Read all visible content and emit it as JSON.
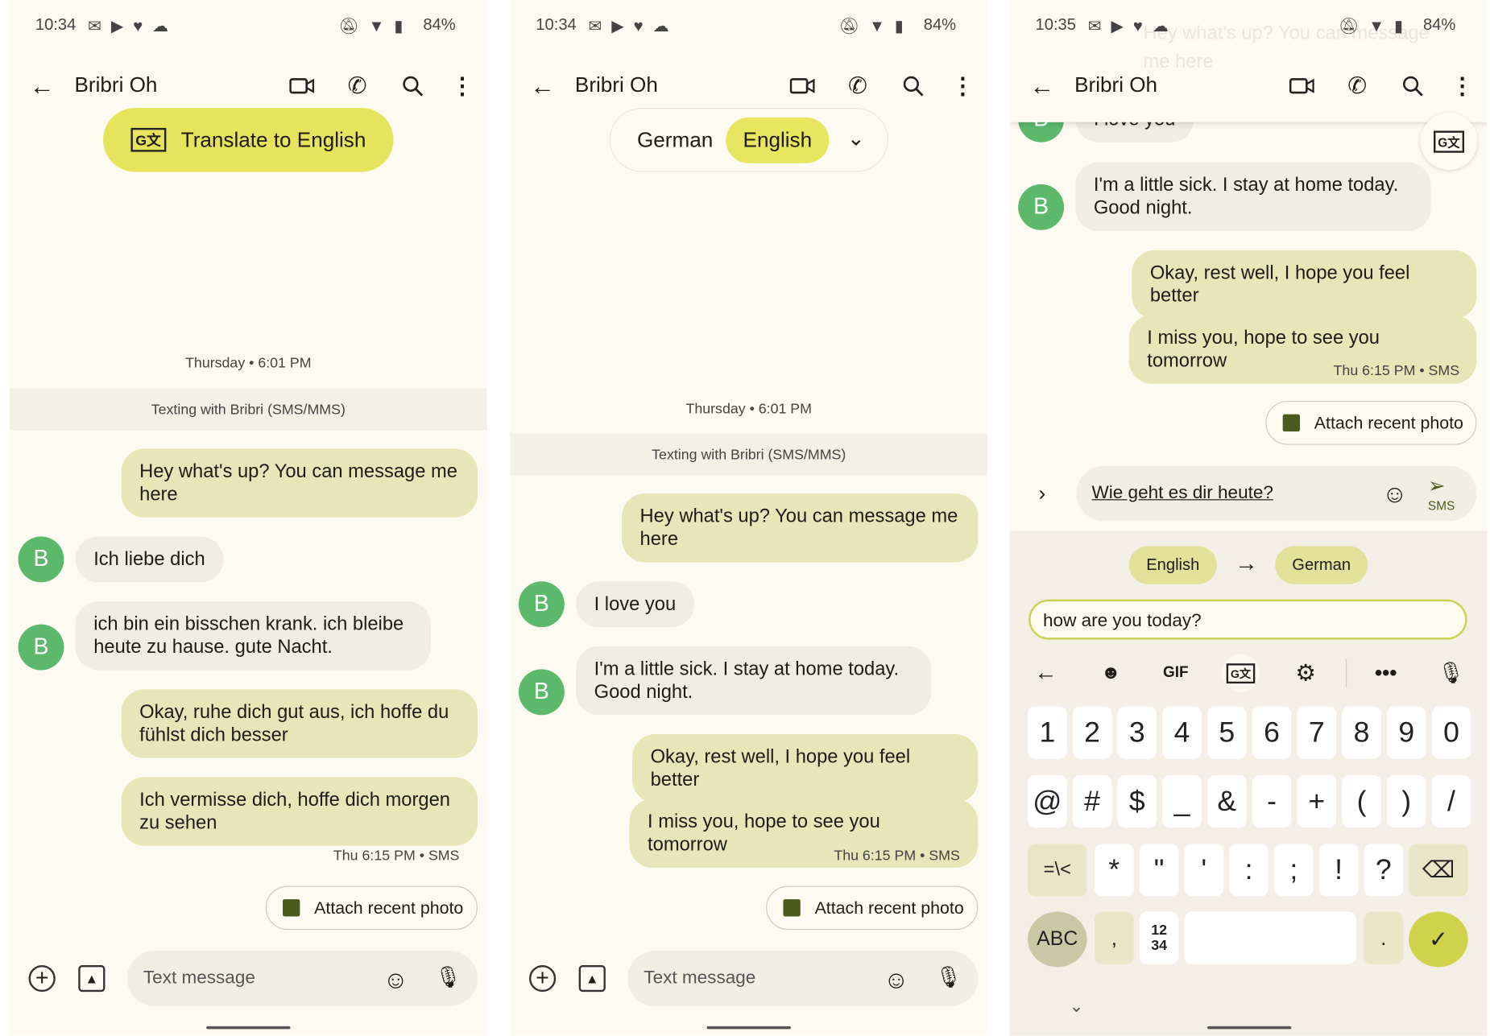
{
  "status_bar": [
    {
      "time": "10:34",
      "battery": "84%"
    },
    {
      "time": "10:34",
      "battery": "84%"
    },
    {
      "time": "10:35",
      "battery": "84%"
    }
  ],
  "contact_name": "Bribri Oh",
  "colors": {
    "background": "#fdfaf1",
    "outgoing_bubble": "#e8e5b8",
    "incoming_bubble": "#f0ede3",
    "avatar": "#5cb96c",
    "accent_yellow": "#e6e35c"
  },
  "panel1": {
    "translate_button": "Translate to English",
    "date_stamp": "Thursday • 6:01 PM",
    "banner": "Texting with Bribri (SMS/MMS)",
    "messages": [
      {
        "direction": "out",
        "text": "Hey what's up? You can message me here"
      },
      {
        "direction": "in",
        "avatar": "B",
        "text": "Ich liebe dich"
      },
      {
        "direction": "in",
        "avatar": "B",
        "text": "ich bin ein bisschen krank. ich bleibe heute zu hause. gute Nacht."
      },
      {
        "direction": "out",
        "text": "Okay, ruhe dich gut aus, ich hoffe du fühlst dich besser"
      },
      {
        "direction": "out",
        "text": "Ich vermisse dich, hoffe dich morgen zu sehen"
      }
    ],
    "meta": "Thu 6:15 PM • SMS",
    "attach_label": "Attach recent photo",
    "input_placeholder": "Text message"
  },
  "panel2": {
    "lang_toggle": {
      "source": "German",
      "target": "English",
      "selected": "English"
    },
    "date_stamp": "Thursday • 6:01 PM",
    "banner": "Texting with Bribri (SMS/MMS)",
    "messages": [
      {
        "direction": "out",
        "text": "Hey what's up? You can message me here"
      },
      {
        "direction": "in",
        "avatar": "B",
        "text": "I love you"
      },
      {
        "direction": "in",
        "avatar": "B",
        "text": "I'm a little sick. I stay at home today. Good night."
      },
      {
        "direction": "out",
        "text": "Okay, rest well, I hope you feel better"
      },
      {
        "direction": "out",
        "text": "I miss you, hope to see you tomorrow"
      }
    ],
    "meta": "Thu 6:15 PM • SMS",
    "attach_label": "Attach recent photo",
    "input_placeholder": "Text message"
  },
  "panel3": {
    "ghost_text": "Hey what's up? You can message me here",
    "messages": [
      {
        "direction": "in",
        "avatar": "B",
        "text": "I love you"
      },
      {
        "direction": "in",
        "avatar": "B",
        "text": "I'm a little sick. I stay at home today. Good night."
      },
      {
        "direction": "out",
        "text": "Okay, rest well, I hope you feel better"
      },
      {
        "direction": "out",
        "text": "I miss you, hope to see you tomorrow"
      }
    ],
    "meta": "Thu 6:15 PM • SMS",
    "attach_label": "Attach recent photo",
    "compose_text": "Wie geht es dir heute?",
    "send_label": "SMS",
    "translate_from": "English",
    "translate_to": "German",
    "translate_input": "how are you today?",
    "keyboard": {
      "toolbar_gif": "GIF",
      "row1": [
        "1",
        "2",
        "3",
        "4",
        "5",
        "6",
        "7",
        "8",
        "9",
        "0"
      ],
      "row2": [
        "@",
        "#",
        "$",
        "_",
        "&",
        "-",
        "+",
        "(",
        ")",
        "/"
      ],
      "row3_shift": "=\\<",
      "row3": [
        "*",
        "\"",
        "'",
        ":",
        ";",
        "!",
        "?"
      ],
      "row4_abc": "ABC",
      "row4_comma": ",",
      "row4_numpad": "12\n34",
      "row4_period": "."
    }
  }
}
